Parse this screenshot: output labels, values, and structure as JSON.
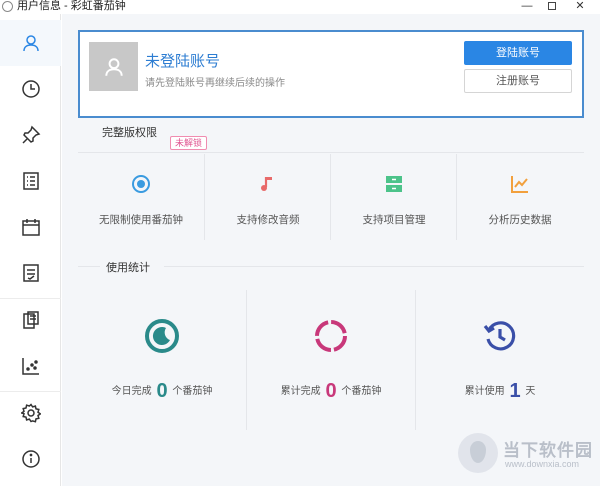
{
  "window": {
    "title": "用户信息 - 彩虹番茄钟",
    "minimize": "—",
    "close": "✕"
  },
  "sidebar": {
    "items": [
      {
        "icon": "user-icon",
        "active": true
      },
      {
        "icon": "clock-icon",
        "active": false
      },
      {
        "icon": "pin-icon",
        "active": false
      },
      {
        "icon": "list-icon",
        "active": false
      },
      {
        "icon": "calendar-icon",
        "active": false
      },
      {
        "icon": "document-icon",
        "active": false
      },
      {
        "icon": "clipboard-icon",
        "active": false
      },
      {
        "icon": "scatter-chart-icon",
        "active": false
      },
      {
        "icon": "gear-icon",
        "active": false
      },
      {
        "icon": "info-icon",
        "active": false
      }
    ]
  },
  "account": {
    "title": "未登陆账号",
    "subtitle": "请先登陆账号再继续后续的操作",
    "login_label": "登陆账号",
    "register_label": "注册账号"
  },
  "premium": {
    "heading": "完整版权限",
    "badge": "未解锁",
    "features": [
      {
        "icon": "target-icon",
        "color": "#3a9be0",
        "label": "无限制使用番茄钟"
      },
      {
        "icon": "music-note-icon",
        "color": "#e86a6a",
        "label": "支持修改音频"
      },
      {
        "icon": "archive-icon",
        "color": "#4cc38a",
        "label": "支持项目管理"
      },
      {
        "icon": "line-chart-icon",
        "color": "#f2a03d",
        "label": "分析历史数据"
      }
    ]
  },
  "stats": {
    "heading": "使用统计",
    "items": [
      {
        "icon": "moon-clock-icon",
        "color": "#2a8a8a",
        "prefix": "今日完成",
        "value": "0",
        "suffix": "个番茄钟"
      },
      {
        "icon": "dashed-ring-icon",
        "color": "#c8387a",
        "prefix": "累计完成",
        "value": "0",
        "suffix": "个番茄钟"
      },
      {
        "icon": "history-icon",
        "color": "#3a4fa8",
        "prefix": "累计使用",
        "value": "1",
        "suffix": "天"
      }
    ]
  },
  "watermark": {
    "text": "当下软件园",
    "url": "www.downxia.com"
  }
}
